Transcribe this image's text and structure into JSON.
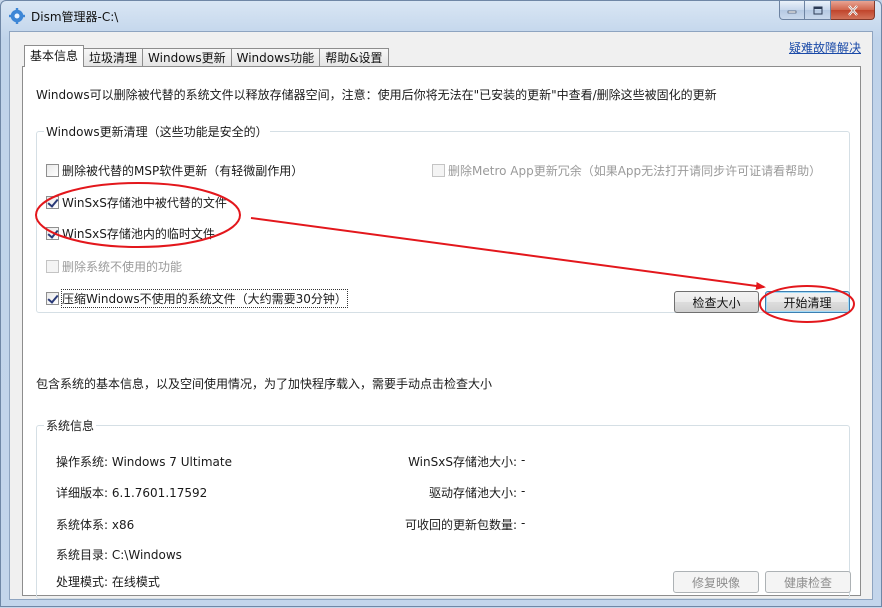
{
  "window": {
    "title": "Dism管理器-C:\\"
  },
  "tabs": [
    {
      "label": "基本信息",
      "active": true
    },
    {
      "label": "垃圾清理",
      "active": false
    },
    {
      "label": "Windows更新",
      "active": false
    },
    {
      "label": "Windows功能",
      "active": false
    },
    {
      "label": "帮助&设置",
      "active": false
    }
  ],
  "help_link": "疑难故障解决",
  "intro_text": "Windows可以删除被代替的系统文件以释放存储器空间，注意：使用后你将无法在\"已安装的更新\"中查看/删除这些被固化的更新",
  "update_cleanup": {
    "group_title": "Windows更新清理（这些功能是安全的）",
    "options": {
      "msp": {
        "label": "删除被代替的MSP软件更新（有轻微副作用）",
        "checked": false,
        "enabled": true
      },
      "metro": {
        "label": "删除Metro App更新冗余（如果App无法打开请同步许可证请看帮助）",
        "checked": false,
        "enabled": false
      },
      "winsxs_superseded": {
        "label": "WinSxS存储池中被代替的文件",
        "checked": true,
        "enabled": true
      },
      "winsxs_temp": {
        "label": "WinSxS存储池内的临时文件",
        "checked": true,
        "enabled": true
      },
      "unused_features": {
        "label": "删除系统不使用的功能",
        "checked": false,
        "enabled": false
      },
      "compress": {
        "label": "压缩Windows不使用的系统文件（大约需要30分钟）",
        "checked": true,
        "enabled": true
      }
    },
    "check_size_button": "检查大小",
    "start_cleanup_button": "开始清理"
  },
  "system_note": "包含系统的基本信息，以及空间使用情况，为了加快程序载入，需要手动点击检查大小",
  "system_info": {
    "group_title": "系统信息",
    "os_label": "操作系统:",
    "os_value": "Windows 7 Ultimate",
    "version_label": "详细版本:",
    "version_value": "6.1.7601.17592",
    "arch_label": "系统体系:",
    "arch_value": "x86",
    "dir_label": "系统目录:",
    "dir_value": "C:\\Windows",
    "mode_label": "处理模式:",
    "mode_value": "在线模式",
    "winsxs_size_label": "WinSxS存储池大小:",
    "winsxs_size_value": "-",
    "driver_store_label": "驱动存储池大小:",
    "driver_store_value": "-",
    "reclaimable_label": "可收回的更新包数量:",
    "reclaimable_value": "-",
    "repair_image_button": "修复映像",
    "health_check_button": "健康检查"
  },
  "colors": {
    "annotation": "#e3171c",
    "link": "#1a4aa8"
  }
}
